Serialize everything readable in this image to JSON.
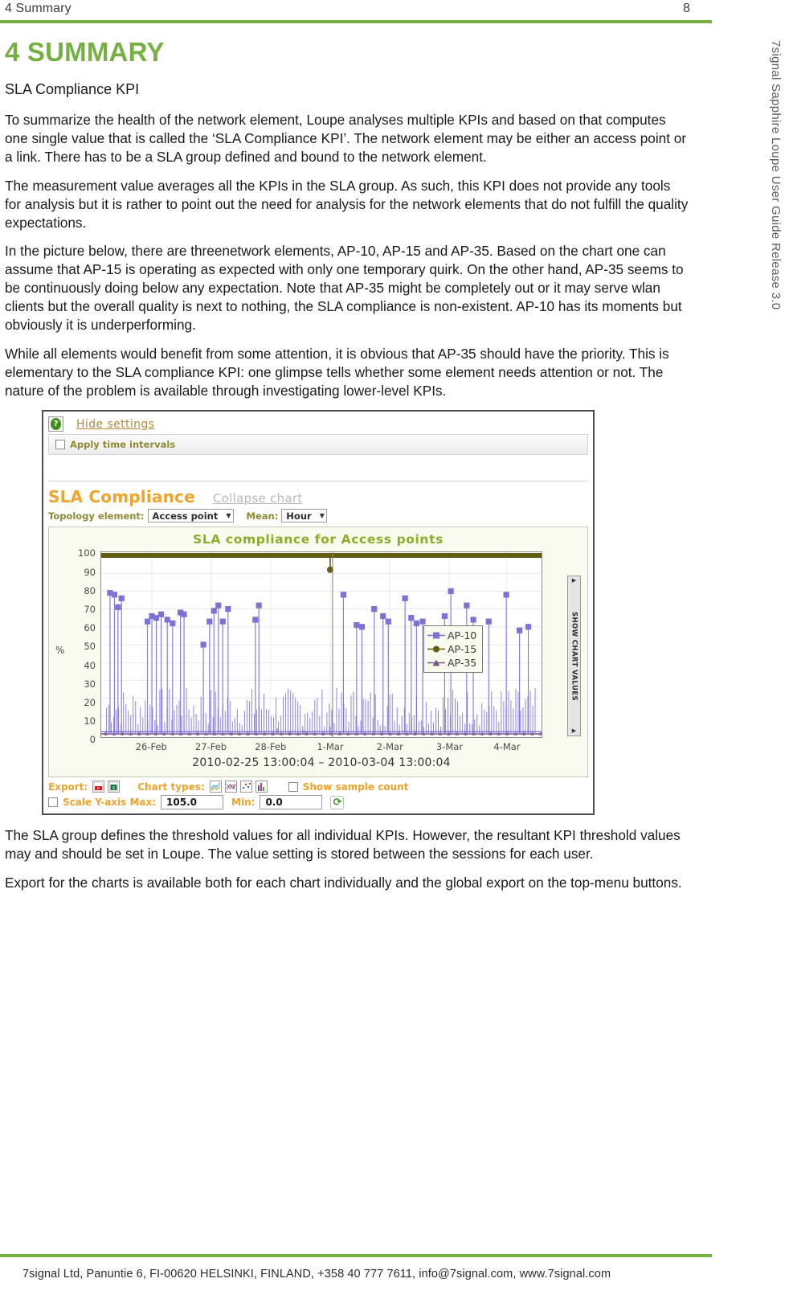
{
  "header": {
    "title": "4 Summary",
    "page_number": "8"
  },
  "side_title": "7signal Sapphire Loupe User Guide Release 3.0",
  "content": {
    "chapter_title": "4 SUMMARY",
    "subhead": "SLA Compliance KPI",
    "paragraphs": [
      "To summarize the health of the network element, Loupe analyses multiple KPIs and based on that computes one single value that is called the ‘SLA Compliance KPI’. The network element may be either an access point or a link. There has to be a SLA group defined and bound to the network element.",
      "The measurement value averages all the KPIs in the SLA group. As such, this KPI does not provide any tools for analysis but it is rather to point out the need for analysis for the network elements that do not fulfill the quality expectations.",
      "In the picture below, there are threenetwork elements, AP-10, AP-15 and AP-35. Based on the chart one can assume that AP-15 is operating as expected with only one temporary quirk. On the other hand, AP-35 seems to be continuously doing below any expectation. Note that AP-35 might be completely out or it may serve wlan clients but the overall quality is next to nothing, the SLA compliance is non-existent. AP-10 has its moments but obviously it is underperforming.",
      " While all elements would benefit from some attention, it is obvious that AP-35 should have the priority. This is elementary to the SLA compliance KPI: one glimpse tells whether some element needs attention or not. The nature of the problem is available through investigating lower-level KPIs."
    ],
    "paragraphs_after": [
      "The SLA group defines the threshold values for all individual KPIs. However, the resultant KPI threshold values may and should be set in Loupe. The value setting is stored between the sessions for each user.",
      "Export for the charts is available both for each chart individually and the global export on the top-menu buttons."
    ]
  },
  "screenshot": {
    "help_icon": "help-icon",
    "hide_settings_link": "Hide settings",
    "apply_time_intervals": {
      "label": "Apply time intervals",
      "checked": false
    },
    "panel_title": "SLA Compliance",
    "collapse_chart_link": "Collapse chart",
    "topology": {
      "label": "Topology element:",
      "value": "Access point"
    },
    "mean": {
      "label": "Mean:",
      "value": "Hour"
    },
    "show_chart_values_tab": "SHOW CHART VALUES",
    "export": {
      "label": "Export:",
      "icons": [
        "pdf-export-icon",
        "excel-export-icon"
      ]
    },
    "chart_types": {
      "label": "Chart types:",
      "icons": [
        "line-chart-icon",
        "scatter-chart-icon",
        "point-chart-icon",
        "bar-chart-icon"
      ]
    },
    "show_sample_count": {
      "label": "Show sample count",
      "checked": false
    },
    "scale_y": {
      "label": "Scale Y-axis Max:",
      "checked": false,
      "max_value": "105.0",
      "min_label": "Min:",
      "min_value": "0.0",
      "refresh_icon": "refresh-icon"
    }
  },
  "chart_data": {
    "type": "line",
    "title": "SLA compliance for Access points",
    "xlabel": "2010-02-25 13:00:04 – 2010-03-04 13:00:04",
    "ylabel": "%",
    "ylim": [
      0,
      100
    ],
    "yticks": [
      100,
      90,
      80,
      70,
      60,
      50,
      40,
      30,
      20,
      10,
      0
    ],
    "xticks": [
      "26-Feb",
      "27-Feb",
      "28-Feb",
      "1-Mar",
      "2-Mar",
      "3-Mar",
      "4-Mar"
    ],
    "xtick_positions_pct": [
      11.5,
      25.0,
      38.5,
      52.0,
      65.5,
      79.0,
      92.0
    ],
    "grid": true,
    "legend_position": "right-middle",
    "colors": {
      "AP-10": "#7b72d6",
      "AP-15": "#615e13",
      "AP-35": "#7a5a86"
    },
    "series": [
      {
        "name": "AP-10",
        "marker": "square",
        "color": "#7b72d6",
        "points": [
          {
            "x": 2.0,
            "y": 79
          },
          {
            "x": 3.0,
            "y": 78
          },
          {
            "x": 3.8,
            "y": 71
          },
          {
            "x": 4.6,
            "y": 76
          },
          {
            "x": 10.5,
            "y": 63
          },
          {
            "x": 11.5,
            "y": 66
          },
          {
            "x": 12.5,
            "y": 65
          },
          {
            "x": 13.6,
            "y": 67
          },
          {
            "x": 15.0,
            "y": 64
          },
          {
            "x": 16.2,
            "y": 62
          },
          {
            "x": 18.0,
            "y": 68
          },
          {
            "x": 18.8,
            "y": 67
          },
          {
            "x": 23.2,
            "y": 50
          },
          {
            "x": 24.6,
            "y": 63
          },
          {
            "x": 25.6,
            "y": 69
          },
          {
            "x": 26.6,
            "y": 72
          },
          {
            "x": 27.6,
            "y": 63
          },
          {
            "x": 28.8,
            "y": 70
          },
          {
            "x": 35.0,
            "y": 64
          },
          {
            "x": 35.8,
            "y": 72
          },
          {
            "x": 40.0,
            "y": 3
          },
          {
            "x": 43.0,
            "y": 2
          },
          {
            "x": 46.0,
            "y": 2
          },
          {
            "x": 52.0,
            "y": 4
          },
          {
            "x": 55.0,
            "y": 78
          },
          {
            "x": 58.0,
            "y": 61
          },
          {
            "x": 59.2,
            "y": 60
          },
          {
            "x": 62.0,
            "y": 70
          },
          {
            "x": 64.0,
            "y": 66
          },
          {
            "x": 65.2,
            "y": 63
          },
          {
            "x": 69.0,
            "y": 76
          },
          {
            "x": 70.4,
            "y": 65
          },
          {
            "x": 71.6,
            "y": 62
          },
          {
            "x": 73.0,
            "y": 63
          },
          {
            "x": 78.0,
            "y": 66
          },
          {
            "x": 79.4,
            "y": 80
          },
          {
            "x": 83.0,
            "y": 72
          },
          {
            "x": 84.5,
            "y": 64
          },
          {
            "x": 88.0,
            "y": 63
          },
          {
            "x": 92.0,
            "y": 78
          },
          {
            "x": 95.0,
            "y": 58
          },
          {
            "x": 97.0,
            "y": 60
          }
        ]
      },
      {
        "name": "AP-15",
        "marker": "circle",
        "color": "#615e13",
        "baseline": 100,
        "dip": {
          "x": 52.0,
          "y": 92
        },
        "points": [
          {
            "x": 0,
            "y": 100
          },
          {
            "x": 52.0,
            "y": 92
          },
          {
            "x": 100,
            "y": 100
          }
        ]
      },
      {
        "name": "AP-35",
        "marker": "triangle",
        "color": "#7a5a86",
        "baseline": 0,
        "points": [
          {
            "x": 0,
            "y": 0
          },
          {
            "x": 50,
            "y": 0
          },
          {
            "x": 100,
            "y": 0
          }
        ]
      }
    ]
  },
  "footer": {
    "text": "7signal Ltd, Panuntie 6, FI-00620 HELSINKI, FINLAND, +358 40 777 7611, info@7signal.com, www.7signal.com"
  }
}
